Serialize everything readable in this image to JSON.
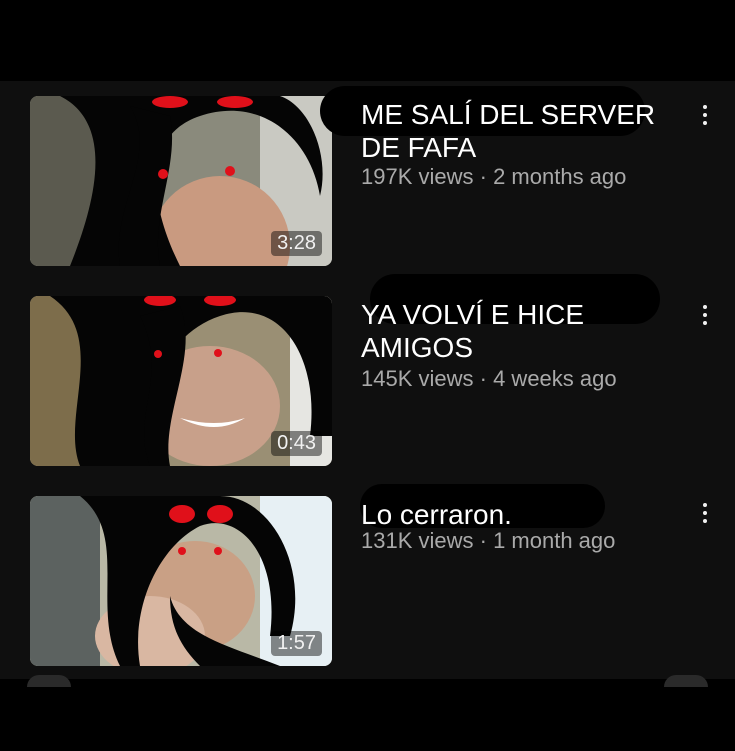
{
  "videos": [
    {
      "title": "ME SALÍ DEL SERVER DE FAFA",
      "views": "197K views",
      "age": "2 months ago",
      "duration": "3:28",
      "menu_icon": "more-vert-icon"
    },
    {
      "title": "YA VOLVÍ E HICE AMIGOS",
      "views": "145K views",
      "age": "4 weeks ago",
      "duration": "0:43",
      "menu_icon": "more-vert-icon"
    },
    {
      "title": "Lo cerraron.",
      "views": "131K views",
      "age": "1 month ago",
      "duration": "1:57",
      "menu_icon": "more-vert-icon"
    }
  ],
  "meta_separator": " · ",
  "colors": {
    "background": "#0f0f0f",
    "title": "#ffffff",
    "meta": "#aaaaaa",
    "eyes": "#e0101a"
  }
}
